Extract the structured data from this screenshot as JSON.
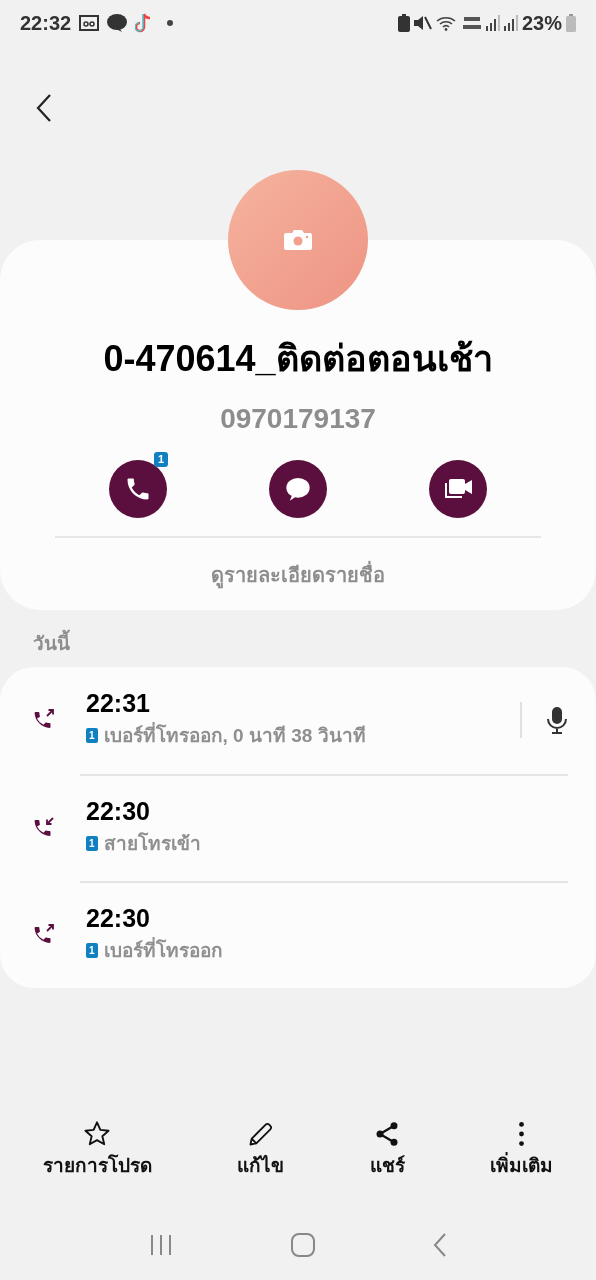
{
  "status_bar": {
    "time": "22:32",
    "battery": "23%"
  },
  "contact": {
    "name": "0-470614_ติดต่อตอนเช้า",
    "phone": "0970179137"
  },
  "actions": [
    {
      "kind": "call",
      "badge": "1"
    },
    {
      "kind": "message"
    },
    {
      "kind": "video"
    }
  ],
  "details_link": "ดูรายละเอียดรายชื่อ",
  "section_label": "วันนี้",
  "calls": [
    {
      "kind": "outgoing",
      "time": "22:31",
      "sim": "1",
      "description": "เบอร์ที่โทรออก, 0 นาที 38 วินาที",
      "recording": true
    },
    {
      "kind": "incoming",
      "time": "22:30",
      "sim": "1",
      "description": "สายโทรเข้า",
      "recording": false
    },
    {
      "kind": "outgoing",
      "time": "22:30",
      "sim": "1",
      "description": "เบอร์ที่โทรออก",
      "recording": false
    }
  ],
  "toolbar": [
    {
      "kind": "favorite",
      "label": "รายการโปรด"
    },
    {
      "kind": "edit",
      "label": "แก้ไข"
    },
    {
      "kind": "share",
      "label": "แชร์"
    },
    {
      "kind": "more",
      "label": "เพิ่มเติม"
    }
  ]
}
